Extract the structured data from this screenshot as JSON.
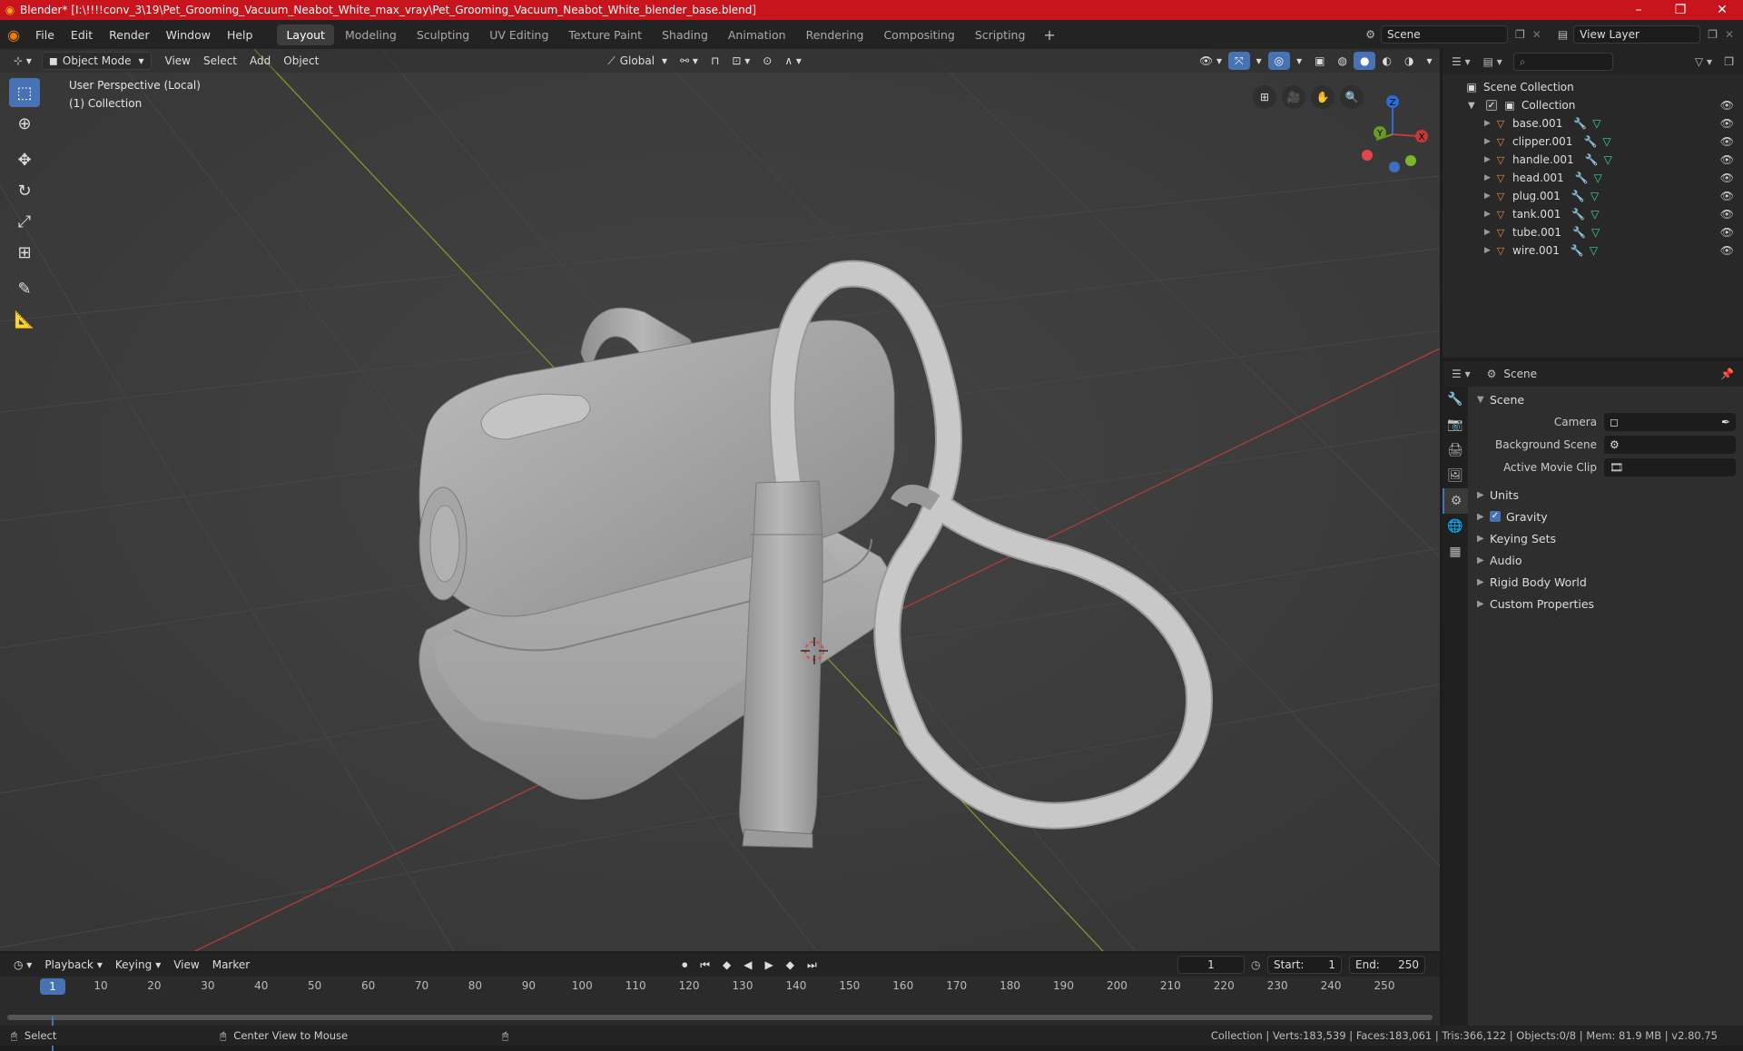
{
  "titlebar": {
    "title": "Blender* [I:\\!!!!conv_3\\19\\Pet_Grooming_Vacuum_Neabot_White_max_vray\\Pet_Grooming_Vacuum_Neabot_White_blender_base.blend]",
    "minimize": "–",
    "maximize": "❐",
    "close": "✕"
  },
  "menubar": {
    "menus": [
      "File",
      "Edit",
      "Render",
      "Window",
      "Help"
    ],
    "workspaces": [
      "Layout",
      "Modeling",
      "Sculpting",
      "UV Editing",
      "Texture Paint",
      "Shading",
      "Animation",
      "Rendering",
      "Compositing",
      "Scripting"
    ],
    "active_workspace": "Layout",
    "add_workspace": "+",
    "scene_name": "Scene",
    "view_layer": "View Layer"
  },
  "viewport": {
    "mode": "Object Mode",
    "menus": [
      "View",
      "Select",
      "Add",
      "Object"
    ],
    "transform_orientation": "Global",
    "info_line1": "User Perspective (Local)",
    "info_line2": "(1) Collection",
    "gizmo_axes": [
      "X",
      "Y",
      "Z"
    ]
  },
  "outliner": {
    "root": "Scene Collection",
    "collection": "Collection",
    "items": [
      "base.001",
      "clipper.001",
      "handle.001",
      "head.001",
      "plug.001",
      "tank.001",
      "tube.001",
      "wire.001"
    ]
  },
  "properties": {
    "header": "Scene",
    "panel": "Scene",
    "fields": [
      {
        "label": "Camera",
        "value": ""
      },
      {
        "label": "Background Scene",
        "value": ""
      },
      {
        "label": "Active Movie Clip",
        "value": ""
      }
    ],
    "sections": [
      "Units",
      "Gravity",
      "Keying Sets",
      "Audio",
      "Rigid Body World",
      "Custom Properties"
    ],
    "gravity_checked": true
  },
  "timeline": {
    "menus": [
      "Playback",
      "Keying",
      "View",
      "Marker"
    ],
    "current_frame": "1",
    "start_label": "Start:",
    "start_value": "1",
    "end_label": "End:",
    "end_value": "250",
    "ticks": [
      "1",
      "10",
      "20",
      "30",
      "40",
      "50",
      "60",
      "70",
      "80",
      "90",
      "100",
      "110",
      "120",
      "130",
      "140",
      "150",
      "160",
      "170",
      "180",
      "190",
      "200",
      "210",
      "220",
      "230",
      "240",
      "250"
    ]
  },
  "statusbar": {
    "left1": "Select",
    "left2": "Center View to Mouse",
    "stats": "Collection | Verts:183,539 | Faces:183,061 | Tris:366,122 | Objects:0/8 | Mem: 81.9 MB | v2.80.75"
  }
}
